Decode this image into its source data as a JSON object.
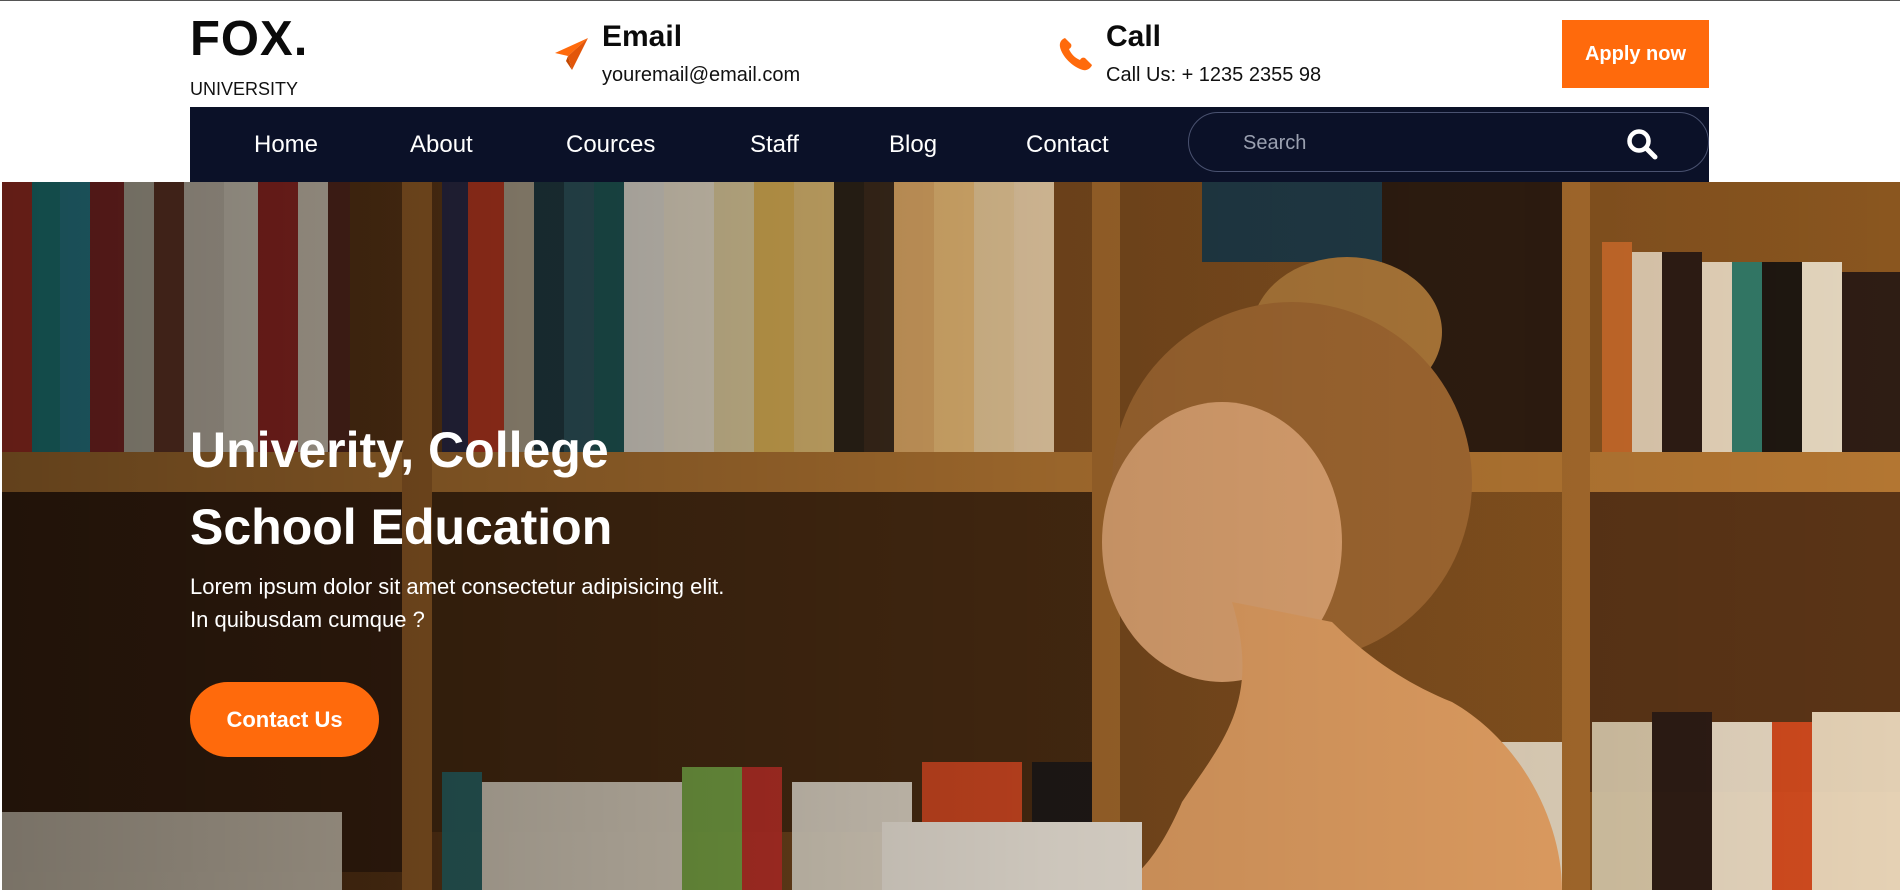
{
  "brand": {
    "name": "FOX.",
    "subtitle": "UNIVERSITY"
  },
  "header": {
    "email": {
      "title": "Email",
      "value": "youremail@email.com",
      "icon": "paper-plane-icon"
    },
    "call": {
      "title": "Call",
      "value": "Call Us: + 1235 2355 98",
      "icon": "phone-icon"
    },
    "apply_label": "Apply now"
  },
  "nav": {
    "items": [
      {
        "label": "Home"
      },
      {
        "label": "About"
      },
      {
        "label": "Cources"
      },
      {
        "label": "Staff"
      },
      {
        "label": "Blog"
      },
      {
        "label": "Contact"
      }
    ],
    "search": {
      "placeholder": "Search",
      "value": "",
      "icon": "search-icon"
    }
  },
  "hero": {
    "title_line1": "Univerity, College",
    "title_line2": "School Education",
    "desc_line1": "Lorem ipsum dolor sit amet consectetur adipisicing elit.",
    "desc_line2": "In quibusdam cumque ?",
    "cta_label": "Contact Us",
    "image": "student-reading-in-library-photo"
  },
  "colors": {
    "accent": "#ff6a0c",
    "nav_bg": "#0b1128",
    "text_dark": "#0b0b0b"
  }
}
